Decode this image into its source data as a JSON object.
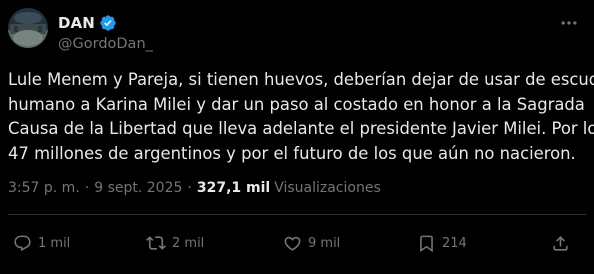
{
  "author": {
    "display_name": "DAN",
    "handle": "@GordoDan_",
    "verified_icon": "verified-badge-icon"
  },
  "tweet": {
    "lines": [
      "Lule Menem y Pareja, si tienen huevos, deberían dejar de usar de escudo",
      "humano a Karina Milei y dar un paso al costado en honor a la Sagrada",
      "Causa de la Libertad que lleva adelante el presidente Javier Milei. Por los",
      "47 millones de argentinos y por el futuro de los que aún no nacieron."
    ]
  },
  "meta": {
    "time": "3:57 p. m.",
    "separator": "·",
    "date": "9 sept. 2025",
    "views_count": "327,1 mil",
    "views_label": "Visualizaciones"
  },
  "actions": {
    "reply": {
      "icon": "reply-icon",
      "count": "1 mil"
    },
    "repost": {
      "icon": "repost-icon",
      "count": "2 mil"
    },
    "like": {
      "icon": "heart-icon",
      "count": "9 mil"
    },
    "bookmark": {
      "icon": "bookmark-icon",
      "count": "214"
    },
    "share": {
      "icon": "share-icon"
    }
  },
  "colors": {
    "background": "#000000",
    "primary_text": "#e7e9ea",
    "secondary_text": "#71767b",
    "verified": "#1d9bf0",
    "divider": "#2f3336"
  }
}
